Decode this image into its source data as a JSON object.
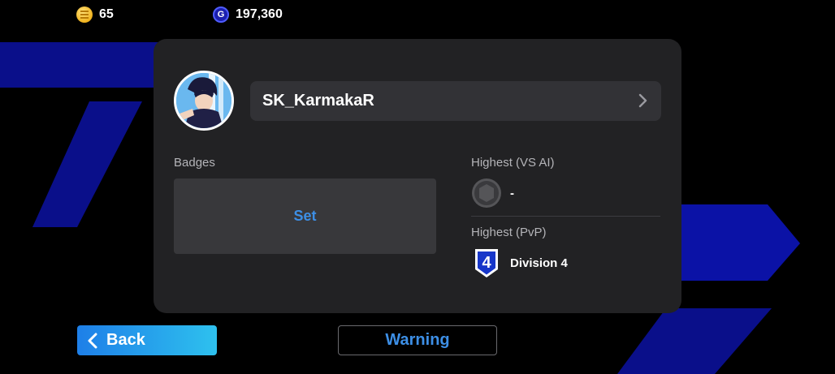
{
  "currencies": {
    "coins": {
      "value": "65",
      "icon": "coin-icon"
    },
    "gp": {
      "value": "197,360",
      "icon": "gp-icon",
      "symbol": "G"
    }
  },
  "profile": {
    "username": "SK_KarmakaR",
    "avatar": "avatar-anime-character"
  },
  "badges": {
    "label": "Badges",
    "set_label": "Set"
  },
  "highest_vs_ai": {
    "label": "Highest (VS AI)",
    "value": "-",
    "icon": "empty-rank-icon"
  },
  "highest_pvp": {
    "label": "Highest (PvP)",
    "value": "Division 4",
    "division_number": "4",
    "icon": "division-badge-icon"
  },
  "buttons": {
    "back": "Back",
    "warning": "Warning"
  },
  "colors": {
    "accent_blue": "#3d8fe6",
    "card_bg": "#222224",
    "background_stripes": "#0a0f9e"
  }
}
